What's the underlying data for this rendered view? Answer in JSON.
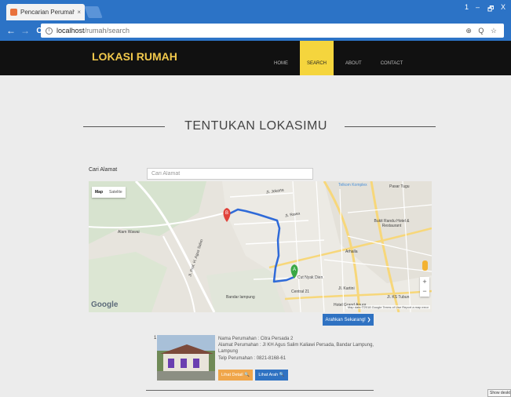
{
  "browser": {
    "tab_title": "Pencarian Perumahan Tr",
    "tab_close": "×",
    "url_host": "localhost",
    "url_path": "/rumah/search",
    "window_controls": [
      "1",
      "–",
      "🗗",
      "X"
    ],
    "nav": {
      "back": "←",
      "forward": "→",
      "reload": "C"
    },
    "omnibox_icons": "⊕ Q ☆"
  },
  "site": {
    "brand": "LOKASI RUMAH",
    "nav": [
      {
        "label": "HOME",
        "active": false
      },
      {
        "label": "SEARCH",
        "active": true
      },
      {
        "label": "ABOUT",
        "active": false
      },
      {
        "label": "CONTACT",
        "active": false
      }
    ]
  },
  "page": {
    "title": "TENTUKAN LOKASIMU",
    "address_label": "Cari Alamat",
    "address_placeholder": "Cari Alamat"
  },
  "map": {
    "type_buttons": [
      "Map",
      "Satelite"
    ],
    "labels": {
      "telkom": "Telkom Komplex",
      "pasar_tugu": "Pasar Tugu",
      "jl_jokarta": "Jl. Jokarta",
      "bukit_randu": "Bukit Randu Hotel & Restaurant",
      "alam_wawai": "Alam Wawai",
      "jl_rawa": "Jl. Rawa",
      "arhalla": "Arhalla",
      "jl_agus_salim": "Jl. Prof. H. Agus Salim",
      "cut_nyak": "Cut Nyak Dien",
      "central21": "Central 21",
      "bandar_lampung": "Bandar lampung",
      "hotel_grand": "Hotel Grand Anugr",
      "jl_kartini": "Jl. Kartini",
      "jl_kstubun": "Jl. KS Tubun",
      "marker_a": "A",
      "marker_b": "B"
    },
    "google": "Google",
    "footer": "Map data ©2018 Google   Terms of Use   Report a map error",
    "zoom_in": "+",
    "zoom_out": "−"
  },
  "route_button": "Arahkan Sekarang! ❯",
  "result": {
    "index": "1",
    "lines": [
      "Nama Perumahan : Citra Persada 2",
      "Alamat Perumahan : Jl KH Agus Salim Kaliawi Persada, Bandar Lampung, Lampung",
      "Telp Perumahan : 0821-8168-61"
    ],
    "detail_button": "Lihat Detail 🔍",
    "route_button": "Lihat Arah 🔍"
  },
  "taskbar_hint": "Show desktop",
  "colors": {
    "browser_blue": "#2c73c6",
    "brand_yellow": "#f2c94c",
    "active_nav": "#f5d53d",
    "primary_button": "#2f72c2",
    "warning_button": "#f0a64a",
    "route_line": "#2f6ad8"
  }
}
